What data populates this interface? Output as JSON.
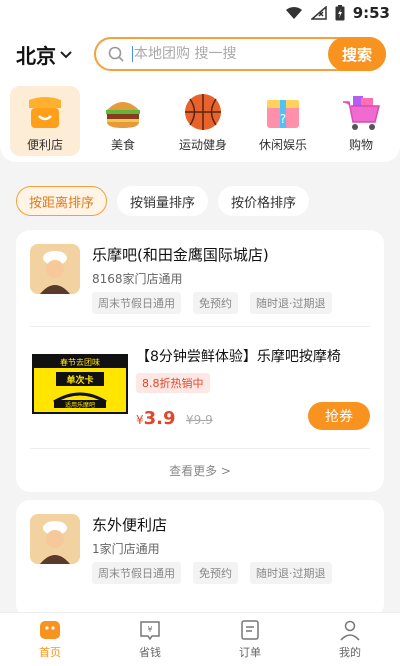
{
  "status_bar": {
    "time": "9:53"
  },
  "header": {
    "city": "北京",
    "search_placeholder": "本地团购 搜一搜",
    "search_button": "搜索"
  },
  "categories": [
    {
      "label": "便利店",
      "icon": "shop-icon",
      "active": true
    },
    {
      "label": "美食",
      "icon": "burger-icon"
    },
    {
      "label": "运动健身",
      "icon": "basketball-icon"
    },
    {
      "label": "休闲娱乐",
      "icon": "gift-box-icon"
    },
    {
      "label": "购物",
      "icon": "shopping-cart-icon"
    }
  ],
  "sort_options": [
    {
      "label": "按距离排序",
      "active": true
    },
    {
      "label": "按销量排序"
    },
    {
      "label": "按价格排序"
    }
  ],
  "stores": [
    {
      "name": "乐摩吧(和田金鹰国际城店)",
      "branches": "8168家门店通用",
      "tags": [
        "周末节假日通用",
        "免预约",
        "随时退·过期退"
      ],
      "deal": {
        "image_top_text": "春节去团味",
        "image_card_text": "单次卡",
        "image_bottom_text": "适用乐摩吧",
        "title": "【8分钟尝鲜体验】乐摩吧按摩椅",
        "badge": "8.8折热销中",
        "price_symbol": "¥",
        "price": "3.9",
        "original_price": "¥9.9",
        "button": "抢券"
      },
      "more": "查看更多 >"
    },
    {
      "name": "东外便利店",
      "branches": "1家门店通用",
      "tags": [
        "周末节假日通用",
        "免预约",
        "随时退·过期退"
      ]
    }
  ],
  "tabbar": [
    {
      "label": "首页",
      "icon": "home-icon",
      "active": true
    },
    {
      "label": "省钱",
      "icon": "coupon-icon"
    },
    {
      "label": "订单",
      "icon": "order-icon"
    },
    {
      "label": "我的",
      "icon": "profile-icon"
    }
  ],
  "colors": {
    "accent": "#f7931e",
    "price_red": "#e0462b",
    "chip_active_bg": "#fff4e6"
  }
}
